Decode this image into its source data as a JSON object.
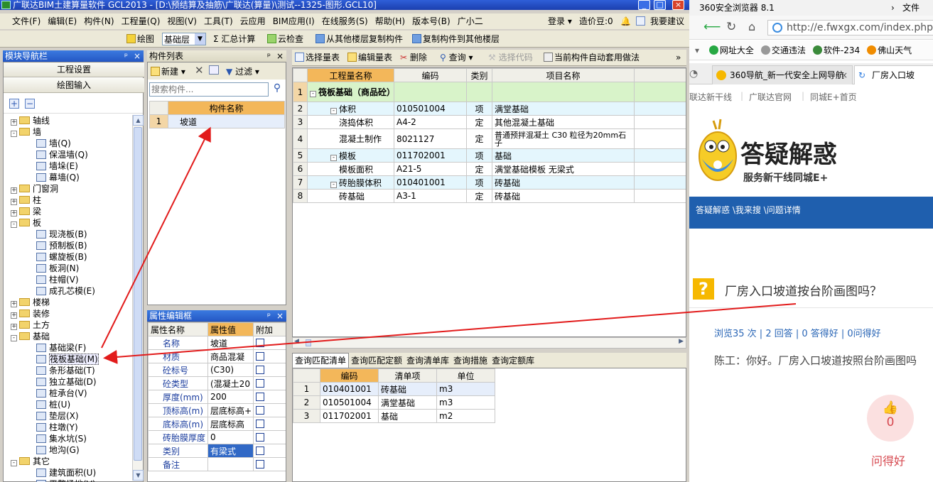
{
  "app": {
    "title": "广联达BIM土建算量软件 GCL2013 - [D:\\预结算及抽筋\\广联达(算量)\\测试--1325-图形.GCL10]",
    "menu": [
      "文件(F)",
      "编辑(E)",
      "构件(N)",
      "工程量(Q)",
      "视图(V)",
      "工具(T)",
      "云应用",
      "BIM应用(I)",
      "在线服务(S)",
      "帮助(H)",
      "版本号(B)",
      "广小二"
    ],
    "menu_right": {
      "login": "登录 ▾",
      "price_bean": "造价豆:0",
      "suggest": "我要建议"
    },
    "toolbar": {
      "draw": "绘图",
      "layer": "基础层",
      "sum": "Σ 汇总计算",
      "cloud_check": "云检查",
      "copy_from": "从其他楼层复制构件",
      "copy_to": "复制构件到其他楼层"
    }
  },
  "nav": {
    "title": "模块导航栏",
    "buttons": [
      "工程设置",
      "绘图输入"
    ],
    "tree": [
      {
        "label": "轴线",
        "type": "folder",
        "pm": "+"
      },
      {
        "label": "墙",
        "type": "folder",
        "pm": "-"
      },
      {
        "label": "墙(Q)",
        "type": "leaf"
      },
      {
        "label": "保温墙(Q)",
        "type": "leaf"
      },
      {
        "label": "墙垛(E)",
        "type": "leaf"
      },
      {
        "label": "幕墙(Q)",
        "type": "leaf"
      },
      {
        "label": "门窗洞",
        "type": "folder",
        "pm": "+"
      },
      {
        "label": "柱",
        "type": "folder",
        "pm": "+"
      },
      {
        "label": "梁",
        "type": "folder",
        "pm": "+"
      },
      {
        "label": "板",
        "type": "folder",
        "pm": "-"
      },
      {
        "label": "现浇板(B)",
        "type": "leaf"
      },
      {
        "label": "预制板(B)",
        "type": "leaf"
      },
      {
        "label": "螺旋板(B)",
        "type": "leaf"
      },
      {
        "label": "板洞(N)",
        "type": "leaf"
      },
      {
        "label": "柱帽(V)",
        "type": "leaf"
      },
      {
        "label": "成孔芯模(E)",
        "type": "leaf"
      },
      {
        "label": "楼梯",
        "type": "folder",
        "pm": "+"
      },
      {
        "label": "装修",
        "type": "folder",
        "pm": "+"
      },
      {
        "label": "土方",
        "type": "folder",
        "pm": "+"
      },
      {
        "label": "基础",
        "type": "folder",
        "pm": "-"
      },
      {
        "label": "基础梁(F)",
        "type": "leaf"
      },
      {
        "label": "筏板基础(M)",
        "type": "leaf",
        "selected": true
      },
      {
        "label": "条形基础(T)",
        "type": "leaf"
      },
      {
        "label": "独立基础(D)",
        "type": "leaf"
      },
      {
        "label": "桩承台(V)",
        "type": "leaf"
      },
      {
        "label": "桩(U)",
        "type": "leaf"
      },
      {
        "label": "垫层(X)",
        "type": "leaf"
      },
      {
        "label": "柱墩(Y)",
        "type": "leaf"
      },
      {
        "label": "集水坑(S)",
        "type": "leaf"
      },
      {
        "label": "地沟(G)",
        "type": "leaf"
      },
      {
        "label": "其它",
        "type": "folder",
        "pm": "-"
      },
      {
        "label": "建筑面积(U)",
        "type": "leaf"
      },
      {
        "label": "平整场地(V)",
        "type": "leaf"
      }
    ]
  },
  "complist": {
    "title": "构件列表",
    "new": "新建",
    "filter": "过滤",
    "search_placeholder": "搜索构件...",
    "col": "构件名称",
    "rows": [
      {
        "num": "1",
        "name": "坡道"
      }
    ]
  },
  "props": {
    "title": "属性编辑框",
    "headers": [
      "属性名称",
      "属性值",
      "附加"
    ],
    "rows": [
      {
        "name": "名称",
        "value": "坡道"
      },
      {
        "name": "材质",
        "value": "商品混凝"
      },
      {
        "name": "砼标号",
        "value": "(C30)"
      },
      {
        "name": "砼类型",
        "value": "(混凝土20"
      },
      {
        "name": "厚度(mm)",
        "value": "200"
      },
      {
        "name": "顶标高(m)",
        "value": "层底标高+"
      },
      {
        "name": "底标高(m)",
        "value": "层底标高"
      },
      {
        "name": "砖胎膜厚度",
        "value": "0"
      },
      {
        "name": "类别",
        "value": "有梁式"
      },
      {
        "name": "备注",
        "value": ""
      }
    ]
  },
  "qty": {
    "toolbar": [
      "选择量表",
      "编辑量表",
      "删除",
      "查询",
      "选择代码",
      "当前构件自动套用做法"
    ],
    "headers": [
      "工程量名称",
      "编码",
      "类别",
      "项目名称"
    ],
    "rows": [
      {
        "num": "1",
        "name": "筏板基础（商品砼）",
        "code": "",
        "cat": "",
        "item": "",
        "level": 0,
        "pm": "-"
      },
      {
        "num": "2",
        "name": "体积",
        "code": "010501004",
        "cat": "项",
        "item": "满堂基础",
        "level": 1,
        "pm": "-"
      },
      {
        "num": "3",
        "name": "浇捣体积",
        "code": "A4-2",
        "cat": "定",
        "item": "其他混凝土基础",
        "level": 2
      },
      {
        "num": "4",
        "name": "混凝土制作",
        "code": "8021127",
        "cat": "定",
        "item": "普通预拌混凝土 C30 粒径为20mm石子",
        "level": 2
      },
      {
        "num": "5",
        "name": "模板",
        "code": "011702001",
        "cat": "项",
        "item": "基础",
        "level": 1,
        "pm": "-"
      },
      {
        "num": "6",
        "name": "模板面积",
        "code": "A21-5",
        "cat": "定",
        "item": "满堂基础模板 无梁式",
        "level": 2
      },
      {
        "num": "7",
        "name": "砖胎膜体积",
        "code": "010401001",
        "cat": "项",
        "item": "砖基础",
        "level": 1,
        "pm": "-"
      },
      {
        "num": "8",
        "name": "砖基础",
        "code": "A3-1",
        "cat": "定",
        "item": "砖基础",
        "level": 2
      }
    ]
  },
  "bottom": {
    "tabs": [
      "查询匹配清单",
      "查询匹配定额",
      "查询清单库",
      "查询措施",
      "查询定额库"
    ],
    "headers": [
      "编码",
      "清单项",
      "单位"
    ],
    "rows": [
      {
        "num": "1",
        "code": "010401001",
        "item": "砖基础",
        "unit": "m3"
      },
      {
        "num": "2",
        "code": "010501004",
        "item": "满堂基础",
        "unit": "m3"
      },
      {
        "num": "3",
        "code": "011702001",
        "item": "基础",
        "unit": "m2"
      }
    ]
  },
  "browser": {
    "title": "360安全浏览器 8.1",
    "file_menu": "文件",
    "url": "http://e.fwxgx.com/index.php?",
    "bookmarks": [
      "网址大全",
      "交通违法",
      "软件-234",
      "佛山天气"
    ],
    "tabs": [
      "360导航_新一代安全上网导航",
      "厂房入口坡"
    ],
    "site_links": [
      "联达新干线",
      "广联达官网",
      "同城E+首页"
    ],
    "logo_title": "答疑解惑",
    "logo_sub": "服务新干线同城E+",
    "breadcrumb": "答疑解惑 \\我来搜 \\问题详情",
    "question": "厂房入口坡道按台阶画图吗？",
    "stats": "浏览35 次 | 2 回答 | 0 答得好 | 0问得好",
    "answer": "陈工：你好。厂房入口坡道按照台阶画图吗",
    "like_count": "0",
    "like_label": "问得好",
    "colors": {
      "accent": "#1f5fae",
      "question_icon": "#f6b800",
      "like_bg": "#fbe0e0",
      "like_fg": "#d6484f"
    }
  }
}
